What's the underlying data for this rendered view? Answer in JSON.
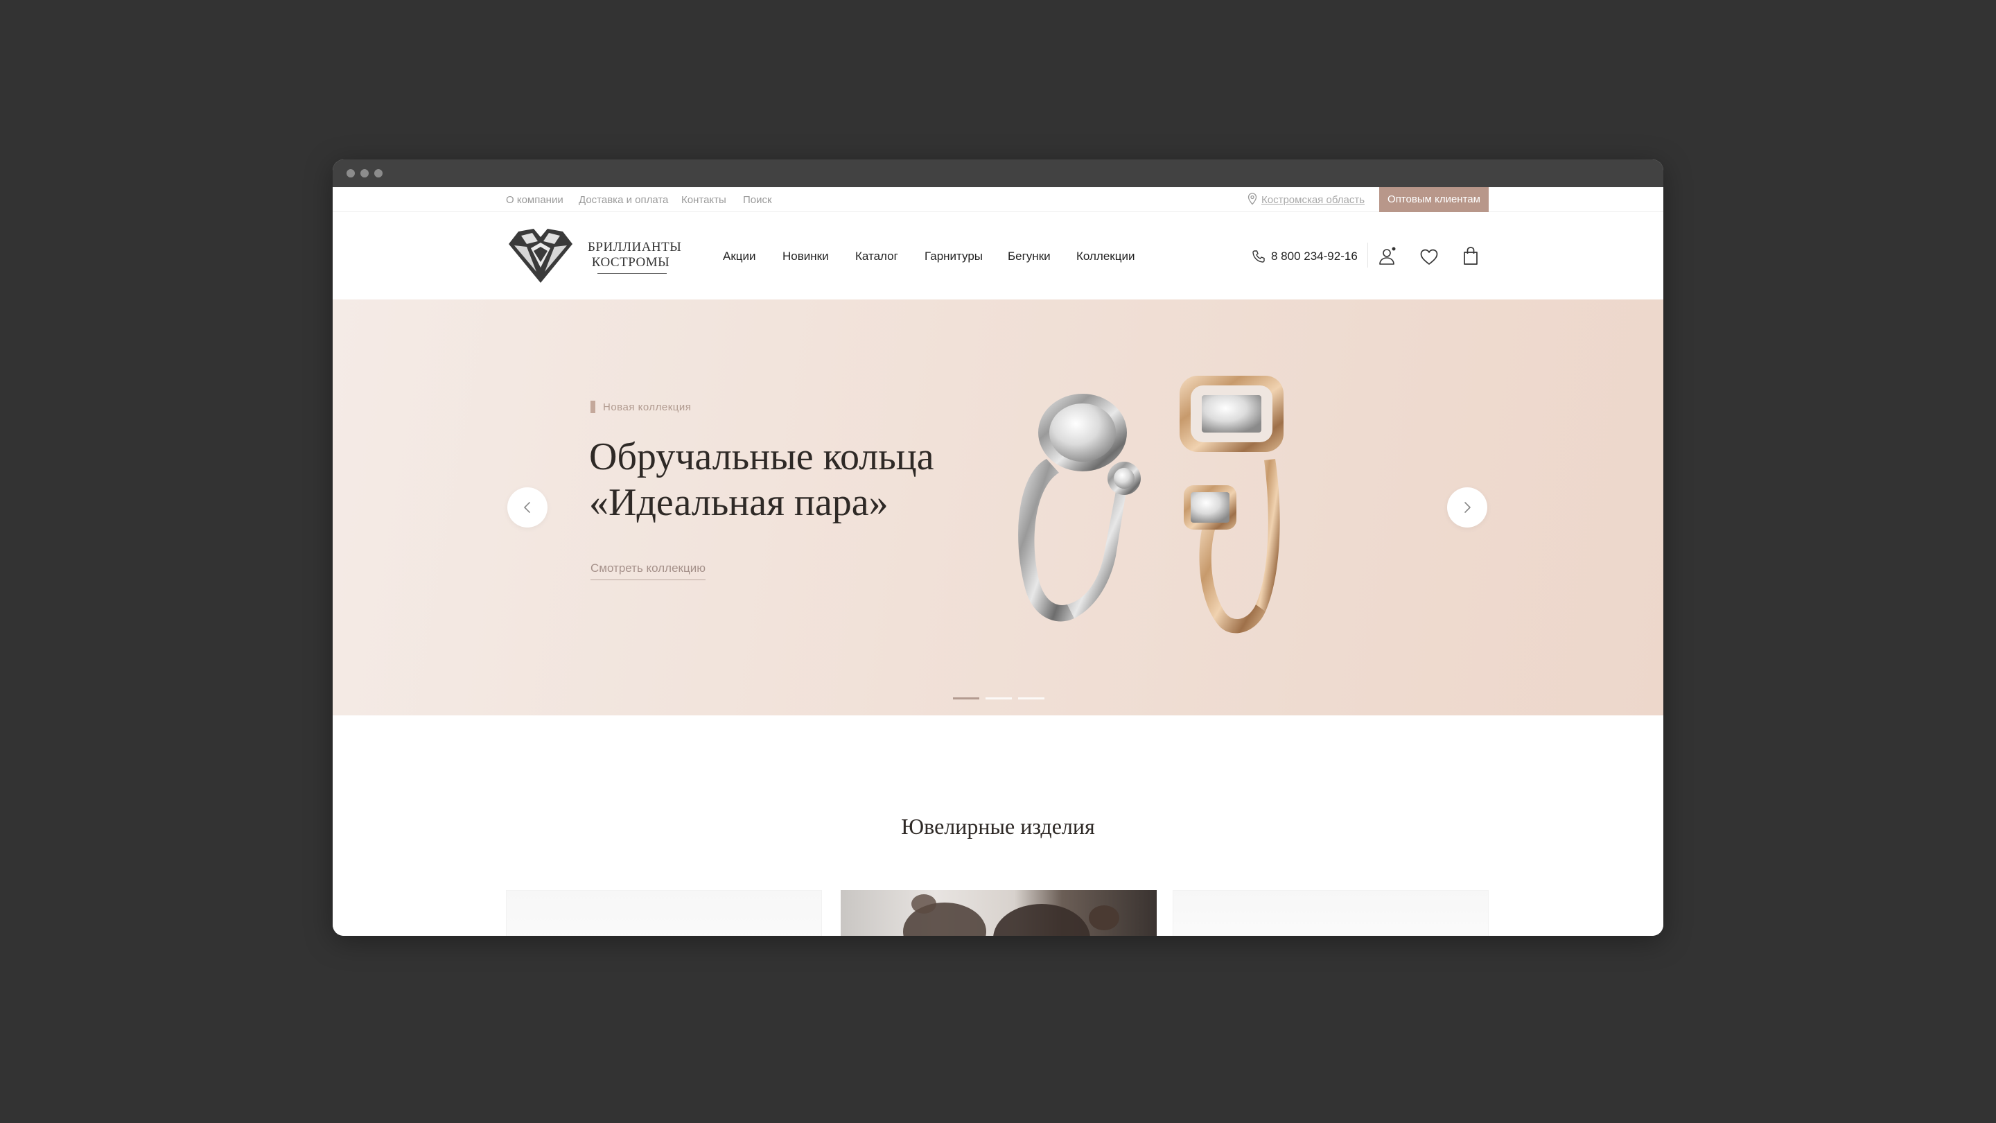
{
  "topbar": {
    "links": [
      "О компании",
      "Доставка и оплата",
      "Контакты",
      "Поиск"
    ],
    "region": "Костромская область",
    "wholesale_button": "Оптовым клиентам"
  },
  "header": {
    "logo_line1": "БРИЛЛИАНТЫ",
    "logo_line2": "КОСТРОМЫ",
    "nav": [
      "Акции",
      "Новинки",
      "Каталог",
      "Гарнитуры",
      "Бегунки",
      "Коллекции"
    ],
    "phone": "8 800 234-92-16",
    "icons": [
      "phone-icon",
      "user-icon",
      "heart-icon",
      "bag-icon"
    ]
  },
  "hero": {
    "eyebrow": "Новая коллекция",
    "title_line1": "Обручальные кольца",
    "title_line2": "«Идеальная пара»",
    "link": "Смотреть коллекцию",
    "slides_total": 3,
    "active_slide": 1
  },
  "section": {
    "title": "Ювелирные изделия"
  },
  "colors": {
    "accent": "#b8978a",
    "hero_bg": "#f1e1d8",
    "page_bg": "#333333"
  }
}
